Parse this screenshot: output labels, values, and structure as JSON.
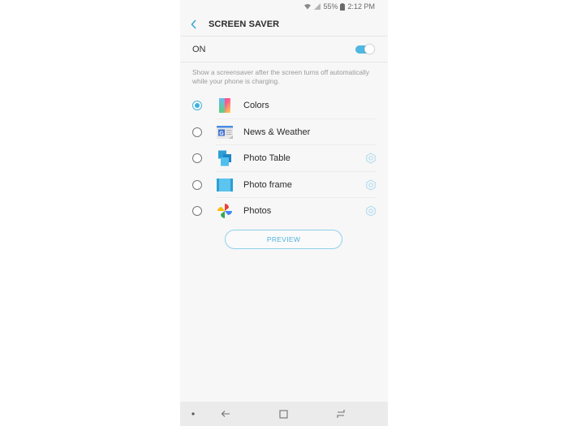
{
  "status_bar": {
    "battery": "55%",
    "time": "2:12 PM",
    "icons": [
      "wifi-icon",
      "signal-icon",
      "battery-icon"
    ]
  },
  "header": {
    "back_icon": "chevron-left-icon",
    "title": "SCREEN SAVER"
  },
  "master_switch": {
    "label": "ON",
    "enabled": true
  },
  "description": "Show a screensaver after the screen turns off automatically while your phone is charging.",
  "options": [
    {
      "label": "Colors",
      "icon": "colors-gradient-icon",
      "selected": true,
      "has_settings": false
    },
    {
      "label": "News & Weather",
      "icon": "news-weather-icon",
      "selected": false,
      "has_settings": false
    },
    {
      "label": "Photo Table",
      "icon": "photo-table-icon",
      "selected": false,
      "has_settings": true
    },
    {
      "label": "Photo frame",
      "icon": "photo-frame-icon",
      "selected": false,
      "has_settings": true
    },
    {
      "label": "Photos",
      "icon": "google-photos-pinwheel-icon",
      "selected": false,
      "has_settings": true
    }
  ],
  "preview_button": "PREVIEW",
  "nav_bar": {
    "items": [
      "dot-icon",
      "back-arrow-icon",
      "home-square-icon",
      "recents-icon"
    ]
  },
  "colors": {
    "accent": "#3fb0de",
    "background": "#f7f7f7",
    "nav_background": "#ebebeb"
  }
}
